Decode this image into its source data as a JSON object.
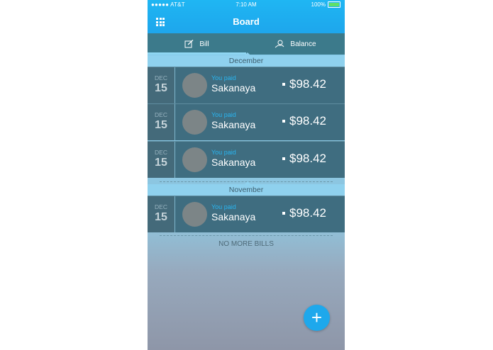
{
  "status_bar": {
    "carrier": "●●●●● AT&T",
    "time": "7:10 AM",
    "battery": "100%"
  },
  "header": {
    "title": "Board",
    "menu_icon": "grid-icon"
  },
  "tabs": [
    {
      "label": "Bill",
      "icon": "edit-icon",
      "active": true
    },
    {
      "label": "Balance",
      "icon": "money-hand-icon",
      "active": false
    }
  ],
  "sections": [
    {
      "month": "December",
      "bills": [
        {
          "month": "DEC",
          "day": "15",
          "caption": "You paid",
          "name": "Sakanaya",
          "amount": "$98.42"
        },
        {
          "month": "DEC",
          "day": "15",
          "caption": "You paid",
          "name": "Sakanaya",
          "amount": "$98.42"
        },
        {
          "month": "DEC",
          "day": "15",
          "caption": "You paid",
          "name": "Sakanaya",
          "amount": "$98.42"
        }
      ]
    },
    {
      "month": "November",
      "bills": [
        {
          "month": "DEC",
          "day": "15",
          "caption": "You paid",
          "name": "Sakanaya",
          "amount": "$98.42"
        }
      ]
    }
  ],
  "footer_text": "NO MORE BILLS",
  "fab": {
    "label": "+",
    "icon": "plus-icon"
  },
  "colors": {
    "accent": "#1ea8ec",
    "row_bg": "#3f6d80",
    "caption": "#29b5f0"
  }
}
